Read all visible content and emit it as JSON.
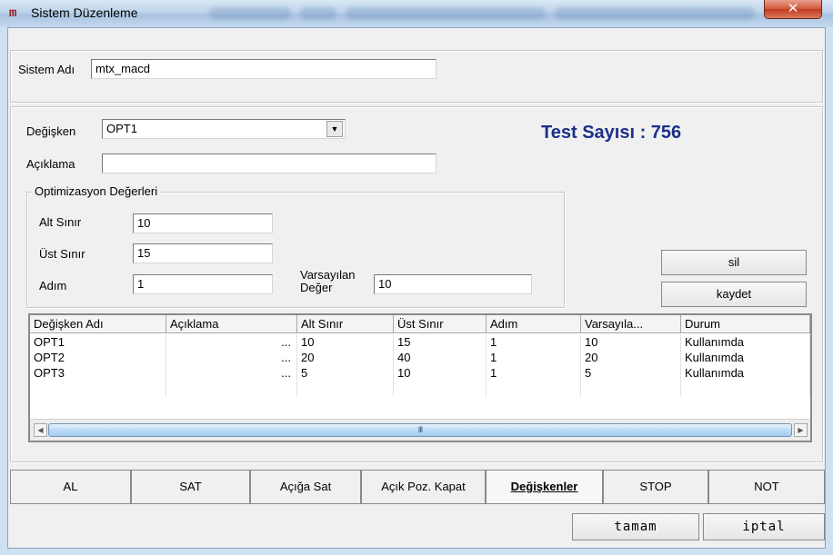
{
  "window": {
    "title": "Sistem Düzenleme",
    "app_icon_glyph": "m",
    "close_glyph": "✕"
  },
  "system": {
    "name_label": "Sistem Adı",
    "name_value": "mtx_macd"
  },
  "variable": {
    "label": "Değişken",
    "selected": "OPT1",
    "description_label": "Açıklama",
    "description_value": ""
  },
  "test_count_text": "Test Sayısı : 756",
  "optimization": {
    "group_title": "Optimizasyon Değerleri",
    "lower_label": "Alt Sınır",
    "lower_value": "10",
    "upper_label": "Üst Sınır",
    "upper_value": "15",
    "step_label": "Adım",
    "step_value": "1",
    "default_label_line1": "Varsayılan",
    "default_label_line2": "Değer",
    "default_value": "10"
  },
  "actions": {
    "delete_label": "sil",
    "save_label": "kaydet"
  },
  "table": {
    "columns": [
      "Değişken Adı",
      "Açıklama",
      "Alt Sınır",
      "Üst Sınır",
      "Adım",
      "Varsayıla...",
      "Durum"
    ],
    "rows": [
      [
        "OPT1",
        "...",
        "10",
        "15",
        "1",
        "10",
        "Kullanımda"
      ],
      [
        "OPT2",
        "...",
        "20",
        "40",
        "1",
        "20",
        "Kullanımda"
      ],
      [
        "OPT3",
        "...",
        "5",
        "10",
        "1",
        "5",
        "Kullanımda"
      ]
    ],
    "scroll_thumb_glyph": "III"
  },
  "tabs": [
    {
      "label": "AL"
    },
    {
      "label": "SAT"
    },
    {
      "label": "Açığa Sat"
    },
    {
      "label": "Açık Poz. Kapat"
    },
    {
      "label": "Değişkenler"
    },
    {
      "label": "STOP"
    },
    {
      "label": "NOT"
    }
  ],
  "footer": {
    "ok_label": "tamam",
    "cancel_label": "iptal"
  }
}
